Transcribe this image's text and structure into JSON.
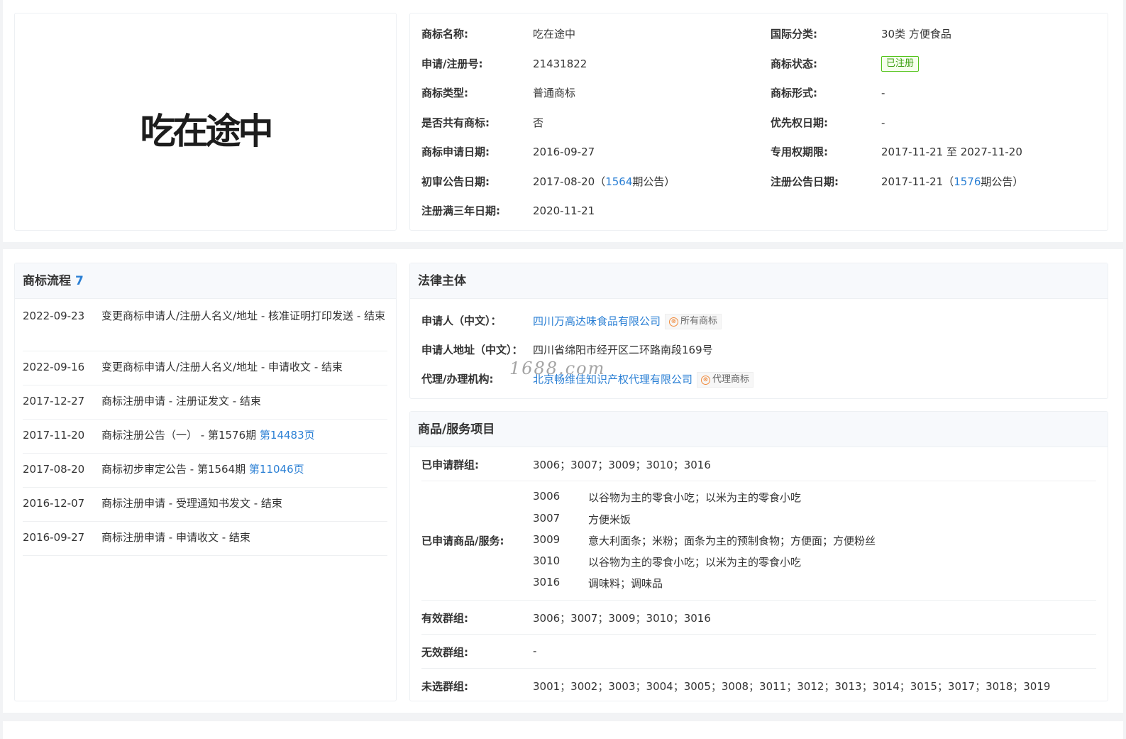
{
  "logo": {
    "text": "吃在途中"
  },
  "info": {
    "left": [
      {
        "label": "商标名称:",
        "value": "吃在途中"
      },
      {
        "label": "申请/注册号:",
        "value": "21431822"
      },
      {
        "label": "商标类型:",
        "value": "普通商标"
      },
      {
        "label": "是否共有商标:",
        "value": "否"
      },
      {
        "label": "商标申请日期:",
        "value": "2016-09-27"
      },
      {
        "label": "初审公告日期:",
        "value_pre": "2017-08-20（",
        "value_link": "1564",
        "value_post": "期公告）"
      },
      {
        "label": "注册满三年日期:",
        "value": "2020-11-21"
      }
    ],
    "right": [
      {
        "label": "国际分类:",
        "value": "30类 方便食品"
      },
      {
        "label": "商标状态:",
        "badge": "已注册"
      },
      {
        "label": "商标形式:",
        "value": "-"
      },
      {
        "label": "优先权日期:",
        "value": "-"
      },
      {
        "label": "专用权期限:",
        "value": "2017-11-21 至 2027-11-20"
      },
      {
        "label": "注册公告日期:",
        "value_pre": "2017-11-21（",
        "value_link": "1576",
        "value_post": "期公告）"
      }
    ]
  },
  "flow": {
    "title": "商标流程",
    "count": "7",
    "rows": [
      {
        "date": "2022-09-23",
        "text": "变更商标申请人/注册人名义/地址 - 核准证明打印发送 - 结束"
      },
      {
        "date": "2022-09-16",
        "text": "变更商标申请人/注册人名义/地址 - 申请收文 - 结束"
      },
      {
        "date": "2017-12-27",
        "text": "商标注册申请 - 注册证发文 - 结束"
      },
      {
        "date": "2017-11-20",
        "text": "商标注册公告（一） - 第1576期 ",
        "link": "第14483页"
      },
      {
        "date": "2017-08-20",
        "text": "商标初步审定公告 - 第1564期 ",
        "link": "第11046页"
      },
      {
        "date": "2016-12-07",
        "text": "商标注册申请 - 受理通知书发文 - 结束"
      },
      {
        "date": "2016-09-27",
        "text": "商标注册申请 - 申请收文 - 结束"
      }
    ]
  },
  "legal": {
    "title": "法律主体",
    "applicant_label": "申请人（中文）：",
    "applicant": "四川万高达味食品有限公司",
    "applicant_tag": "所有商标",
    "address_label": "申请人地址（中文）：",
    "address": "四川省绵阳市经开区二环路南段169号",
    "agent_label": "代理/办理机构:",
    "agent": "北京畅维佳知识产权代理有限公司",
    "agent_tag": "代理商标",
    "tag_icon": "®"
  },
  "goods": {
    "title": "商品/服务项目",
    "applied_groups_label": "已申请群组:",
    "applied_groups": "3006；3007；3009；3010；3016",
    "services_label": "已申请商品/服务:",
    "services": [
      {
        "code": "3006",
        "desc": "以谷物为主的零食小吃；以米为主的零食小吃"
      },
      {
        "code": "3007",
        "desc": "方便米饭"
      },
      {
        "code": "3009",
        "desc": "意大利面条；米粉；面条为主的预制食物；方便面；方便粉丝"
      },
      {
        "code": "3010",
        "desc": "以谷物为主的零食小吃；以米为主的零食小吃"
      },
      {
        "code": "3016",
        "desc": "调味料；调味品"
      }
    ],
    "valid_groups_label": "有效群组:",
    "valid_groups": "3006；3007；3009；3010；3016",
    "invalid_groups_label": "无效群组:",
    "invalid_groups": "-",
    "unselected_groups_label": "未选群组:",
    "unselected_groups": "3001；3002；3003；3004；3005；3008；3011；3012；3013；3014；3015；3017；3018；3019"
  },
  "watermark": "1688.com"
}
